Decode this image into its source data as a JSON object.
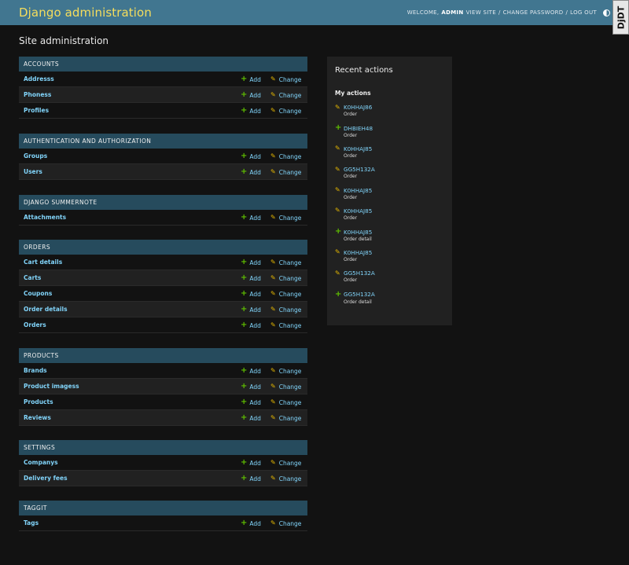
{
  "header": {
    "branding": "Django administration",
    "welcome": "WELCOME,",
    "username": "ADMIN",
    "view_site": "VIEW SITE",
    "change_password": "CHANGE PASSWORD",
    "log_out": "LOG OUT",
    "separator": "/",
    "theme_icon": "theme-toggle-icon",
    "djdt_label": "DjDT"
  },
  "page_title": "Site administration",
  "add_label": "Add",
  "change_label": "Change",
  "modules": [
    {
      "caption": "ACCOUNTS",
      "models": [
        "Addresss",
        "Phoness",
        "Profiles"
      ]
    },
    {
      "caption": "AUTHENTICATION AND AUTHORIZATION",
      "models": [
        "Groups",
        "Users"
      ]
    },
    {
      "caption": "DJANGO SUMMERNOTE",
      "models": [
        "Attachments"
      ]
    },
    {
      "caption": "ORDERS",
      "models": [
        "Cart details",
        "Carts",
        "Coupons",
        "Order details",
        "Orders"
      ]
    },
    {
      "caption": "PRODUCTS",
      "models": [
        "Brands",
        "Product imagess",
        "Products",
        "Reviews"
      ]
    },
    {
      "caption": "SETTINGS",
      "models": [
        "Companys",
        "Delivery fees"
      ]
    },
    {
      "caption": "TAGGIT",
      "models": [
        "Tags"
      ]
    }
  ],
  "recent_actions": {
    "title": "Recent actions",
    "subtitle": "My actions",
    "items": [
      {
        "icon": "pencil-icon",
        "kind": "change",
        "name": "K0HHAJ86",
        "type": "Order"
      },
      {
        "icon": "plus-icon",
        "kind": "add",
        "name": "DHBIEH48",
        "type": "Order"
      },
      {
        "icon": "pencil-icon",
        "kind": "change",
        "name": "K0HHAJ85",
        "type": "Order"
      },
      {
        "icon": "pencil-icon",
        "kind": "change",
        "name": "GG5H132A",
        "type": "Order"
      },
      {
        "icon": "pencil-icon",
        "kind": "change",
        "name": "K0HHAJ85",
        "type": "Order"
      },
      {
        "icon": "pencil-icon",
        "kind": "change",
        "name": "K0HHAJ85",
        "type": "Order"
      },
      {
        "icon": "plus-icon",
        "kind": "add",
        "name": "K0HHAJ85",
        "type": "Order detail"
      },
      {
        "icon": "pencil-icon",
        "kind": "change",
        "name": "K0HHAJ85",
        "type": "Order"
      },
      {
        "icon": "pencil-icon",
        "kind": "change",
        "name": "GG5H132A",
        "type": "Order"
      },
      {
        "icon": "plus-icon",
        "kind": "add",
        "name": "GG5H132A",
        "type": "Order detail"
      }
    ]
  },
  "colors": {
    "header_bg": "#417690",
    "branding": "#f5dd5d",
    "caption_bg": "#264b5d",
    "link": "#81d4fa",
    "add_icon": "#5fbf00",
    "change_icon": "#e6b800",
    "body_bg": "#121212"
  }
}
